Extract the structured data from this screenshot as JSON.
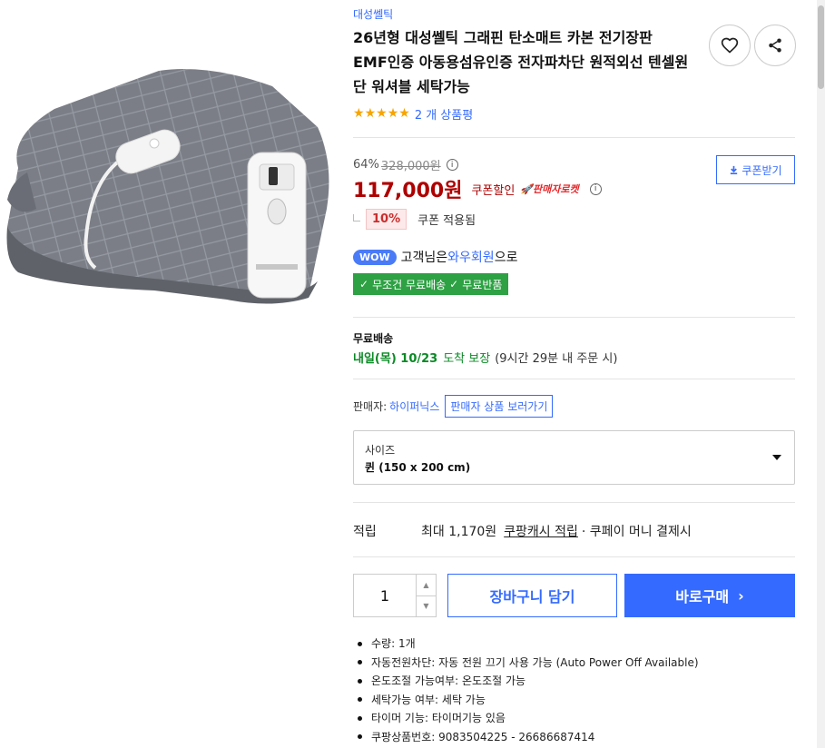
{
  "product": {
    "brand": "대성쎌틱",
    "title": "26년형 대성쎌틱 그래핀 탄소매트 카본 전기장판 EMF인증 아동용섬유인증 전자파차단 원적외선 텐셀원단 워셔블 세탁가능",
    "rating_stars": 5,
    "review_count": "2 개 상품평"
  },
  "price": {
    "discount_rate": "64%",
    "original": "328,000원",
    "sale": "117,000원",
    "coupon_sale_label": "쿠폰할인",
    "seller_rocket": "판매자로켓",
    "coupon_button": "쿠폰받기",
    "coupon_pct": "10%",
    "coupon_applied": "쿠폰 적용됨"
  },
  "wow": {
    "badge": "WOW",
    "prefix": "고객님은 ",
    "link": "와우회원",
    "suffix": "으로",
    "benefit1": "무조건 무료배송",
    "benefit2": "무료반품"
  },
  "shipping": {
    "title": "무료배송",
    "date": "내일(목) 10/23",
    "guarantee": "도착 보장",
    "note": "(9시간 29분 내 주문 시)"
  },
  "seller": {
    "label": "판매자:",
    "name": "하이퍼닉스",
    "link": "판매자 상품 보러가기"
  },
  "option": {
    "label": "사이즈",
    "value": "퀸 (150 x 200 cm)"
  },
  "points": {
    "label": "적립",
    "max": "최대 1,170원",
    "link": "쿠팡캐시 적립",
    "suffix": "· 쿠페이 머니 결제시"
  },
  "purchase": {
    "quantity": "1",
    "cart": "장바구니 담기",
    "buy": "바로구매"
  },
  "attributes": [
    "수량: 1개",
    "자동전원차단: 자동 전원 끄기 사용 가능 (Auto Power Off Available)",
    "온도조절 가능여부: 온도조절 가능",
    "세탁가능 여부: 세탁 가능",
    "타이머 기능: 타이머기능 있음",
    "쿠팡상품번호: 9083504225 - 26686687414"
  ],
  "colors": {
    "accent": "#346aff",
    "price_red": "#ae0000",
    "green": "#2da143"
  }
}
